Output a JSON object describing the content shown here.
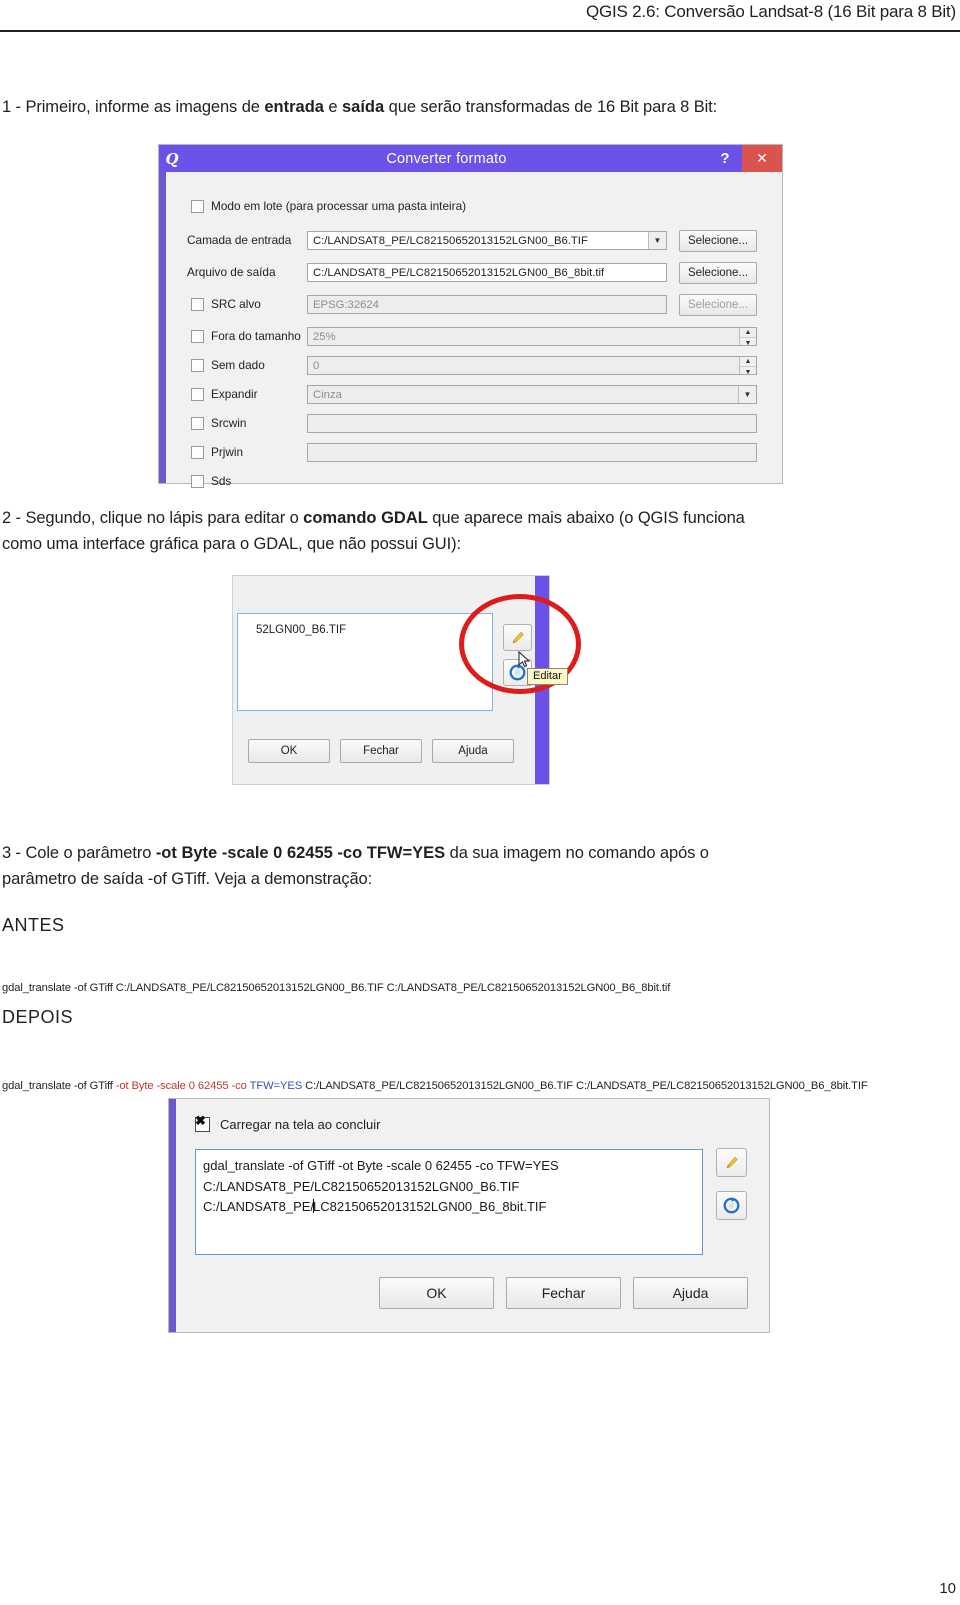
{
  "header": {
    "title": "QGIS 2.6: Conversão Landsat-8 (16 Bit para 8 Bit)"
  },
  "steps": {
    "step1": {
      "pre": "1 - Primeiro, informe as imagens de ",
      "bold1": "entrada",
      "mid": " e ",
      "bold2": "saída",
      "post": " que serão transformadas de 16 Bit para 8 Bit:"
    },
    "step2": {
      "pre": "2 - Segundo, clique no lápis para editar o ",
      "bold1": "comando GDAL",
      "post": " que aparece mais abaixo (o QGIS funciona",
      "line2": "como uma interface gráfica para o GDAL, que não possui GUI):"
    },
    "step3": {
      "pre": "3 - Cole o parâmetro ",
      "bold1": "-ot Byte -scale 0 62455 -co TFW=YES",
      "post": " da sua imagem no comando após o",
      "line2": "parâmetro de saída -of GTiff. Veja a demonstração:"
    }
  },
  "dialog1": {
    "titlebar": {
      "logo": "Q",
      "title": "Converter formato",
      "help": "?",
      "close": "✕"
    },
    "batch_checkbox_label": "Modo em lote (para processar uma pasta inteira)",
    "rows": [
      {
        "label": "Camada de entrada",
        "has_checkbox": false,
        "value": "C:/LANDSAT8_PE/LC82150652013152LGN00_B6.TIF",
        "control": "combo",
        "button": "Selecione...",
        "disabled": false
      },
      {
        "label": "Arquivo de saída",
        "has_checkbox": false,
        "value": "C:/LANDSAT8_PE/LC82150652013152LGN00_B6_8bit.tif",
        "control": "text",
        "button": "Selecione...",
        "disabled": false
      },
      {
        "label": "SRC alvo",
        "has_checkbox": true,
        "value": "EPSG:32624",
        "control": "text",
        "button": "Selecione...",
        "disabled": true
      },
      {
        "label": "Fora do tamanho",
        "has_checkbox": true,
        "value": "25%",
        "control": "spin",
        "button": "",
        "disabled": true
      },
      {
        "label": "Sem dado",
        "has_checkbox": true,
        "value": "0",
        "control": "spin",
        "button": "",
        "disabled": true
      },
      {
        "label": "Expandir",
        "has_checkbox": true,
        "value": "Cinza",
        "control": "combo",
        "button": "",
        "disabled": true
      },
      {
        "label": "Srcwin",
        "has_checkbox": true,
        "value": "",
        "control": "text",
        "button": "",
        "disabled": true
      },
      {
        "label": "Prjwin",
        "has_checkbox": true,
        "value": "",
        "control": "text",
        "button": "",
        "disabled": true
      },
      {
        "label": "Sds",
        "has_checkbox": true,
        "value": "",
        "control": "none",
        "button": "",
        "disabled": true
      }
    ]
  },
  "dialog2": {
    "text_line": "52LGN00_B6.TIF",
    "tooltip": "Editar",
    "buttons": {
      "ok": "OK",
      "close": "Fechar",
      "help": "Ajuda"
    },
    "icons": {
      "edit": "pencil-icon",
      "refresh": "refresh-icon"
    }
  },
  "sections": {
    "antes_title": "ANTES",
    "depois_title": "DEPOIS"
  },
  "commands": {
    "antes": "gdal_translate -of GTiff C:/LANDSAT8_PE/LC82150652013152LGN00_B6.TIF C:/LANDSAT8_PE/LC82150652013152LGN00_B6_8bit.tif",
    "depois_pre": "gdal_translate -of GTiff ",
    "depois_param1": "-ot Byte -scale 0 62455 -co ",
    "depois_param2": "TFW=YES",
    "depois_post": " C:/LANDSAT8_PE/LC82150652013152LGN00_B6.TIF C:/LANDSAT8_PE/LC82150652013152LGN00_B6_8bit.TIF"
  },
  "dialog3": {
    "load_checkbox_label": "Carregar na tela ao concluir",
    "command_line1": "gdal_translate -of GTiff -ot Byte -scale 0 62455 -co TFW=YES",
    "command_line2": "C:/LANDSAT8_PE/LC82150652013152LGN00_B6.TIF",
    "command_line3a": "C:/LANDSAT8_PE/",
    "command_line3b": "LC82150652013152LGN00_B6_8bit.TIF",
    "buttons": {
      "ok": "OK",
      "close": "Fechar",
      "help": "Ajuda"
    },
    "icons": {
      "edit": "pencil-icon",
      "refresh": "refresh-icon"
    }
  },
  "footer": {
    "page_number": "10"
  },
  "colors": {
    "titlebar": "#6c52e8",
    "close_button": "#d9534f",
    "highlight_red": "#c0392b",
    "highlight_blue": "#3b4cc0",
    "annotation_ellipse": "#e01b1b"
  }
}
